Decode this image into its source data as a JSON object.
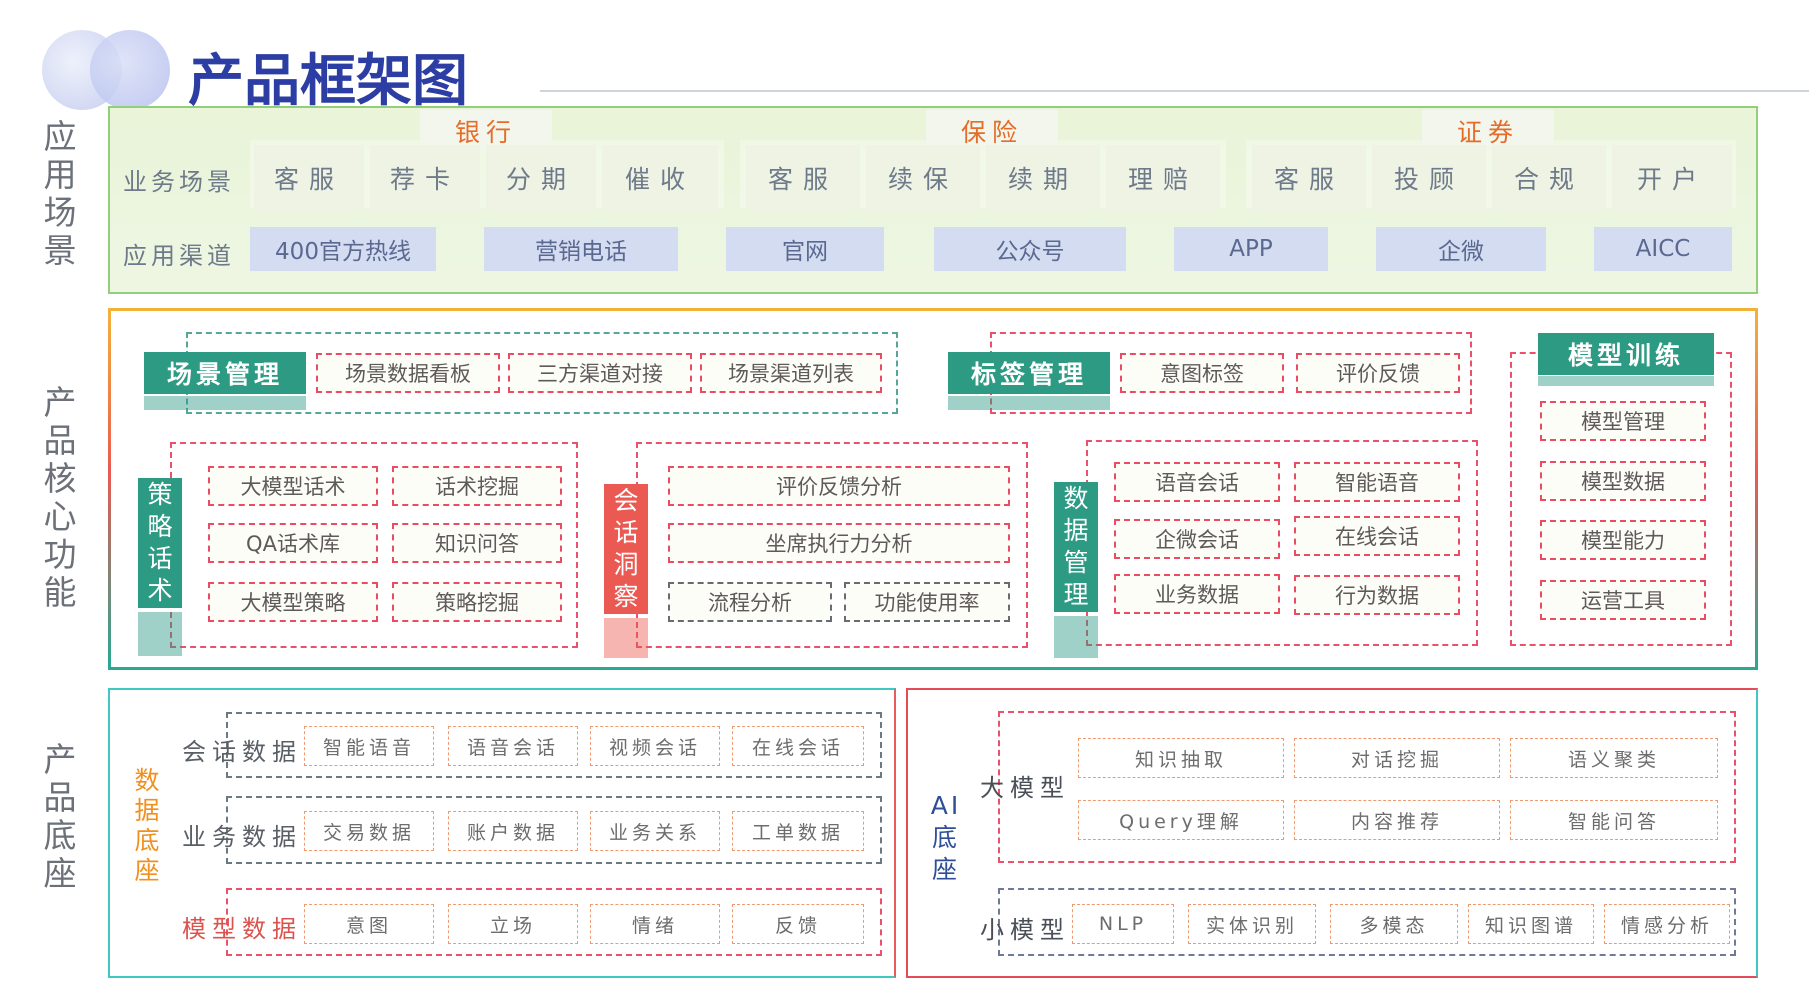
{
  "title": "产品框架图",
  "side_labels": {
    "app": "应用场景",
    "core": "产品核心功能",
    "base": "产品底座"
  },
  "app": {
    "row_labels": [
      "业务场景",
      "应用渠道"
    ],
    "groups": [
      {
        "name": "银行",
        "items": [
          "客服",
          "荐卡",
          "分期",
          "催收"
        ]
      },
      {
        "name": "保险",
        "items": [
          "客服",
          "续保",
          "续期",
          "理赔"
        ]
      },
      {
        "name": "证券",
        "items": [
          "客服",
          "投顾",
          "合规",
          "开户"
        ]
      }
    ],
    "channels": [
      "400官方热线",
      "营销电话",
      "官网",
      "公众号",
      "APP",
      "企微",
      "AICC"
    ]
  },
  "core": {
    "scene_mgmt": {
      "label": "场景管理",
      "items": [
        "场景数据看板",
        "三方渠道对接",
        "场景渠道列表"
      ]
    },
    "tag_mgmt": {
      "label": "标签管理",
      "items": [
        "意图标签",
        "评价反馈"
      ]
    },
    "model_train": {
      "label": "模型训练",
      "items": [
        "模型管理",
        "模型数据",
        "模型能力",
        "运营工具"
      ]
    },
    "strategy": {
      "label": "策略话术",
      "items": [
        "大模型话术",
        "话术挖掘",
        "QA话术库",
        "知识问答",
        "大模型策略",
        "策略挖掘"
      ]
    },
    "insight": {
      "label": "会话洞察",
      "items": [
        "评价反馈分析",
        "坐席执行力分析",
        "流程分析",
        "功能使用率"
      ]
    },
    "data_mgmt": {
      "label": "数据管理",
      "items": [
        "语音会话",
        "智能语音",
        "企微会话",
        "在线会话",
        "业务数据",
        "行为数据"
      ]
    }
  },
  "base": {
    "data": {
      "label": "数据底座",
      "rows": [
        {
          "label": "会话数据",
          "items": [
            "智能语音",
            "语音会话",
            "视频会话",
            "在线会话"
          ]
        },
        {
          "label": "业务数据",
          "items": [
            "交易数据",
            "账户数据",
            "业务关系",
            "工单数据"
          ]
        },
        {
          "label": "模型数据",
          "items": [
            "意图",
            "立场",
            "情绪",
            "反馈"
          ]
        }
      ]
    },
    "ai": {
      "label": "AI底座",
      "large": {
        "label": "大模型",
        "items": [
          "知识抽取",
          "对话挖掘",
          "语义聚类",
          "Query理解",
          "内容推荐",
          "智能问答"
        ]
      },
      "small": {
        "label": "小模型",
        "items": [
          "NLP",
          "实体识别",
          "多模态",
          "知识图谱",
          "情感分析"
        ]
      }
    }
  }
}
